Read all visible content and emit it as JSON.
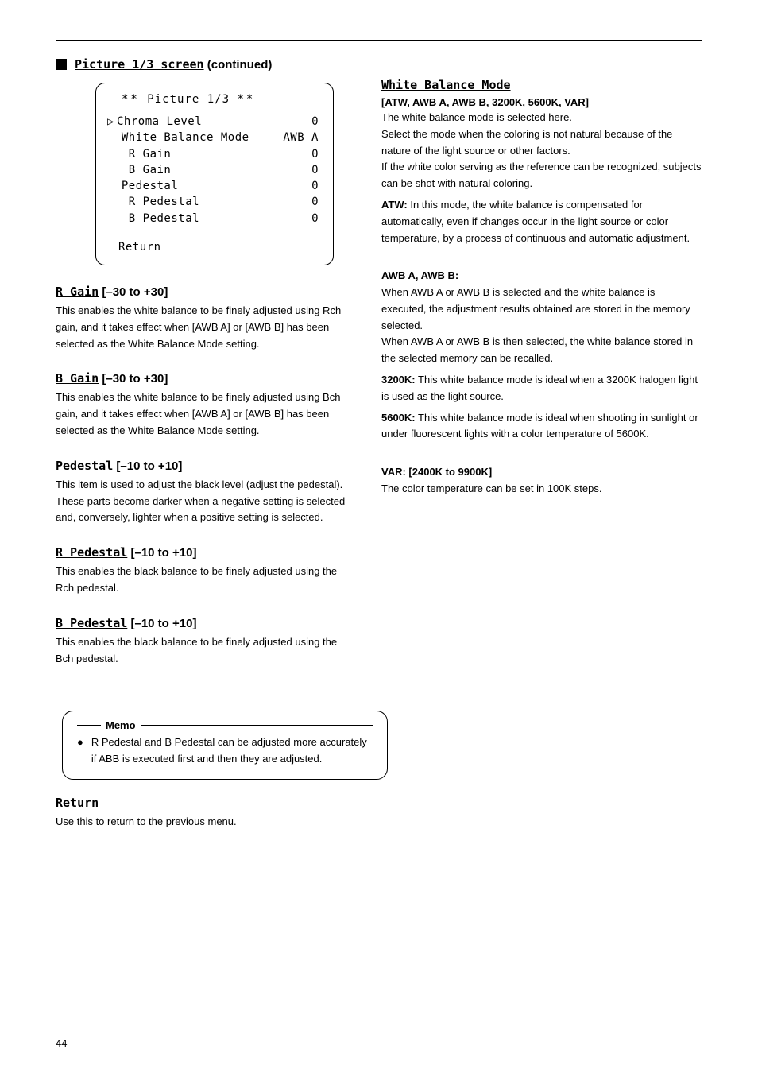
{
  "page_number": "44",
  "top_section": {
    "title_prefix": "Picture 1/3 screen",
    "title_suffix": " (continued)"
  },
  "osd": {
    "title": "** Picture 1/3 **",
    "cursor_symbol": "▷",
    "rows": [
      {
        "label": "Chroma Level",
        "value": "0",
        "indent": 0,
        "cursor": true
      },
      {
        "label": "White Balance Mode",
        "value": "AWB A",
        "indent": 1
      },
      {
        "label": " R Gain",
        "value": "0",
        "indent": 1
      },
      {
        "label": " B Gain",
        "value": "0",
        "indent": 1
      },
      {
        "label": "Pedestal",
        "value": "0",
        "indent": 1
      },
      {
        "label": " R Pedestal",
        "value": "0",
        "indent": 1
      },
      {
        "label": " B Pedestal",
        "value": "0",
        "indent": 1
      }
    ],
    "return": "Return"
  },
  "left_items": [
    {
      "name_underline": "R Gain",
      "range": " [–30 to +30]",
      "desc": "This enables the white balance to be finely adjusted using Rch gain, and it takes effect when [AWB A] or [AWB B] has been selected as the White Balance Mode setting."
    },
    {
      "name_underline": "B Gain",
      "range": " [–30 to +30]",
      "desc": "This enables the white balance to be finely adjusted using Bch gain, and it takes effect when [AWB A] or [AWB B] has been selected as the White Balance Mode setting."
    },
    {
      "name_underline": "Pedestal",
      "range": " [–10 to +10]",
      "desc": "This item is used to adjust the black level (adjust the pedestal). These parts become darker when a negative setting is selected and, conversely, lighter when a positive setting is selected."
    },
    {
      "name_underline": "R Pedestal",
      "range": " [–10 to +10]",
      "desc": "This enables the black balance to be finely adjusted using the Rch pedestal."
    },
    {
      "name_underline": "B Pedestal",
      "range": " [–10 to +10]",
      "desc": "This enables the black balance to be finely adjusted using the Bch pedestal."
    }
  ],
  "memo": {
    "label": "Memo",
    "bullet": "●",
    "text": "R Pedestal and B Pedestal can be adjusted more accurately if ABB is executed first and then they are adjusted."
  },
  "left_return": {
    "name": "Return",
    "desc": "Use this to return to the previous menu."
  },
  "right_items": [
    {
      "name": "White Balance Mode",
      "values": "[ATW, AWB A, AWB B, 3200K, 5600K, VAR]",
      "desc": "The white balance mode is selected here.\nSelect the mode when the coloring is not natural because of the nature of the light source or other factors.\nIf the white color serving as the reference can be recognized, subjects can be shot with natural coloring.",
      "sub": [
        {
          "head": "ATW:",
          "text": " In this mode, the white balance is compensated for automatically, even if changes occur in the light source or color temperature, by a process of continuous and automatic adjustment."
        },
        {
          "head": "AWB A, AWB B:",
          "text": "\n  When AWB A or AWB B is selected and the white balance is executed, the adjustment results obtained are stored in the memory selected.\nWhen AWB A or AWB B is then selected, the white balance stored in the selected memory can be recalled."
        },
        {
          "head": "3200K:",
          "text": " This white balance mode is ideal when a 3200K halogen light is used as the light source."
        },
        {
          "head": "5600K:",
          "text": " This white balance mode is ideal when shooting in sunlight or under fluorescent lights with a color temperature of 5600K."
        },
        {
          "head": "VAR:  [2400K to 9900K]",
          "text": "\n  The color temperature can be set in 100K steps."
        }
      ]
    }
  ]
}
